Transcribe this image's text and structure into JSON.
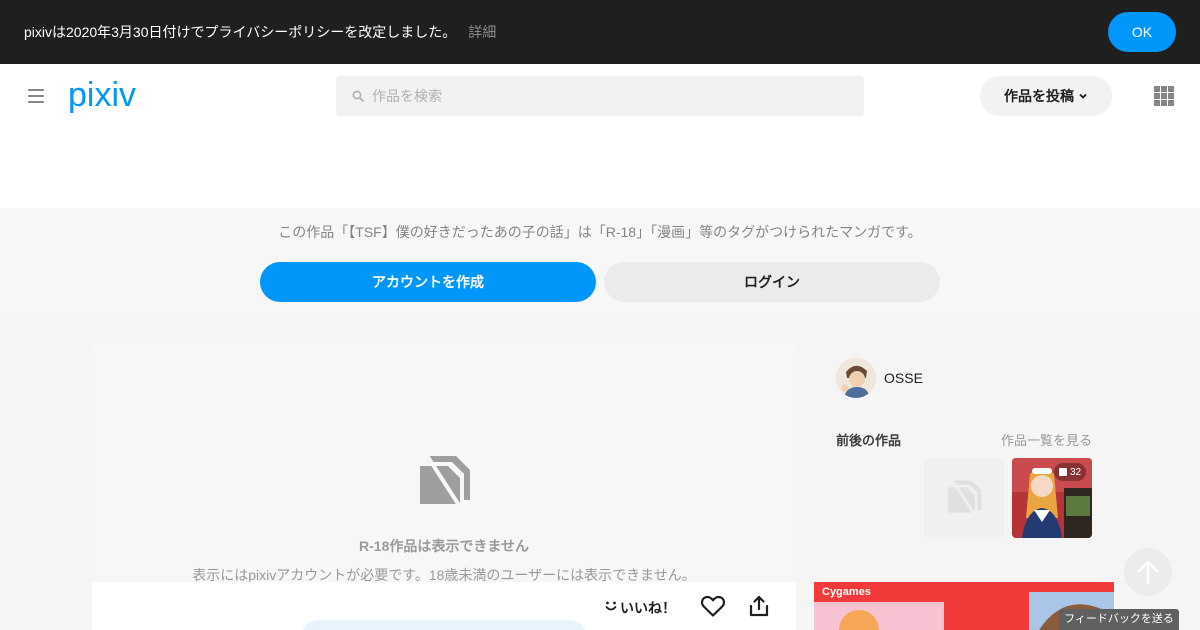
{
  "notice": {
    "text": "pixivは2020年3月30日付けでプライバシーポリシーを改定しました。",
    "detail_link": "詳細",
    "ok_label": "OK"
  },
  "header": {
    "logo_text": "pixiv",
    "search_placeholder": "作品を検索",
    "post_label": "作品を投稿"
  },
  "signup": {
    "message": "この作品「【TSF】僕の好きだったあの子の話」は「R-18」「漫画」等のタグがつけられたマンガです。",
    "create_account_label": "アカウントを作成",
    "login_label": "ログイン"
  },
  "artwork": {
    "blocked_title": "R-18作品は表示できません",
    "blocked_subtitle": "表示にはpixivアカウントが必要です。18歳未満のユーザーには表示できません。",
    "like_label": "いいね！"
  },
  "sidebar": {
    "author_name": "OSSE",
    "prev_next_title": "前後の作品",
    "see_all_label": "作品一覧を見る",
    "page_count": "32"
  },
  "ad": {
    "brand": "Cygames"
  },
  "feedback_label": "フィードバックを送る",
  "colors": {
    "accent": "#0096fa",
    "notice_bg": "#1f1f1f"
  }
}
